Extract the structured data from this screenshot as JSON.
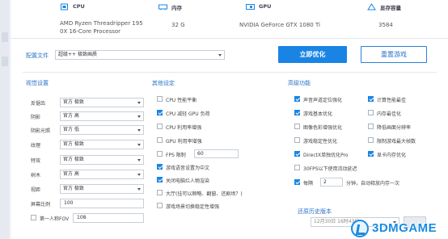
{
  "hardware": {
    "cpu": {
      "title": "CPU",
      "value_line1": "AMD Ryzen Threadripper 195",
      "value_line2": "0X 16-Core Processor"
    },
    "memory": {
      "title": "内存",
      "value": "32 G"
    },
    "gpu": {
      "title": "GPU",
      "value": "NVIDIA GeForce GTX 1080 Ti"
    },
    "vram": {
      "title": "显存容量",
      "value": "3584"
    }
  },
  "config": {
    "label": "配置文件",
    "selected": "超级++ 极致画质",
    "optimize_button": "立即优化",
    "reset_button": "重置游戏"
  },
  "video_settings": {
    "title": "视觉设置",
    "rows": [
      {
        "label": "反锯齿",
        "value": "官方 极致"
      },
      {
        "label": "阴影",
        "value": "官方 高"
      },
      {
        "label": "阴影光照",
        "value": "官方 低"
      },
      {
        "label": "纹理",
        "value": "官方 极致"
      },
      {
        "label": "特效",
        "value": "官方 极致"
      },
      {
        "label": "树木",
        "value": "官方 高"
      },
      {
        "label": "视距",
        "value": "官方 极致"
      }
    ],
    "screen_ratio": {
      "label": "屏幕比例",
      "value": "100"
    },
    "fov": {
      "label": "第一人称FOV",
      "value": "108"
    }
  },
  "other_settings": {
    "title": "其他设定",
    "items": [
      {
        "label": "CPU 性能平衡",
        "checked": false
      },
      {
        "label": "CPU 减轻 GPU 负荷",
        "checked": true
      },
      {
        "label": "CPU 利用率增强",
        "checked": false
      },
      {
        "label": "GPU 利用率增强",
        "checked": false
      },
      {
        "label": "FPS 限制",
        "checked": false,
        "value": "60"
      },
      {
        "label": "游戏语音设置为中文",
        "checked": true
      },
      {
        "label": "关闭电脑烂人物渲染",
        "checked": true
      },
      {
        "label": "大厅(挂可以顺略、翻窗、还剧场？)",
        "checked": false
      },
      {
        "label": "游戏场景切换稳定性增强",
        "checked": false
      }
    ]
  },
  "advanced": {
    "title": "高级功能",
    "items_left": [
      {
        "label": "声音声道定位强化",
        "checked": true
      },
      {
        "label": "游戏基本优化",
        "checked": true
      },
      {
        "label": "图像色彩增强优化",
        "checked": false
      },
      {
        "label": "游戏稳定性优化",
        "checked": false
      },
      {
        "label": "DirectX单独优化Pro",
        "checked": true
      },
      {
        "label": "30FPS以下使用流动延迟",
        "checked": false
      },
      {
        "label": "每隔",
        "checked": true,
        "value": "2",
        "suffix": "分钟，自动释放内存一次"
      }
    ],
    "items_right": [
      {
        "label": "计算性能最佳",
        "checked": true
      },
      {
        "label": "内存最佳化",
        "checked": false
      },
      {
        "label": "降低画面分辨率",
        "checked": false
      },
      {
        "label": "限制游戏最大帧数",
        "checked": false
      },
      {
        "label": "显卡内存优化",
        "checked": true
      }
    ]
  },
  "restore": {
    "title": "还原历史版本",
    "selected": "12月30日 16时43分"
  },
  "watermark": {
    "text": "3DMGAME"
  },
  "colors": {
    "accent": "#1a84e5",
    "label_blue": "#2a72c8",
    "divider": "#e3e7ec"
  }
}
